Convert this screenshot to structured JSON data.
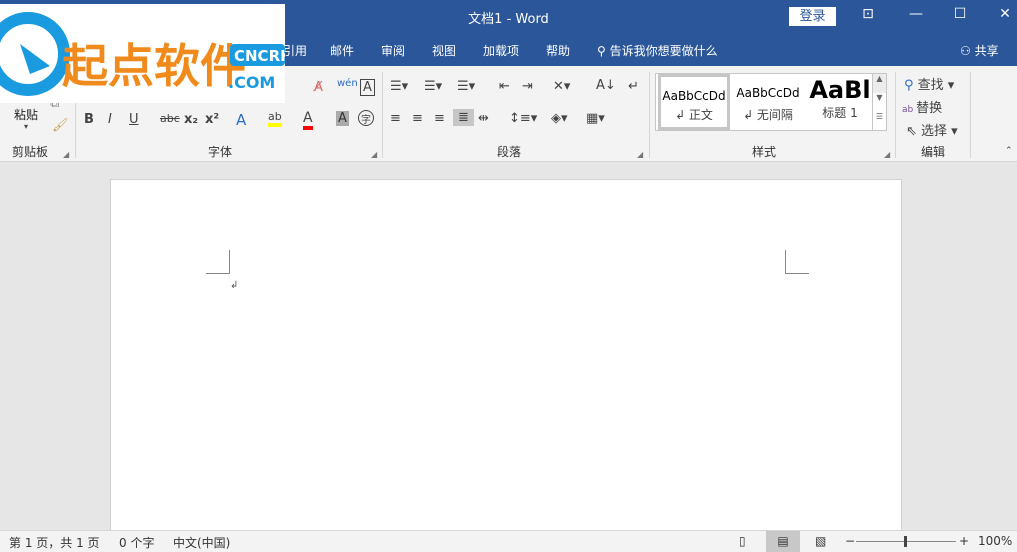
{
  "title": "文档1  -  Word",
  "login": "登录",
  "tabs": [
    "引用",
    "邮件",
    "审阅",
    "视图",
    "加载项",
    "帮助"
  ],
  "tell_me": "告诉我你想要做什么",
  "share": "共享",
  "groups": {
    "clipboard": "剪贴板",
    "font": "字体",
    "paragraph": "段落",
    "styles": "样式",
    "editing": "编辑"
  },
  "paste": "粘贴",
  "font_buttons": {
    "bold": "B",
    "italic": "I",
    "underline": "U",
    "strike": "abc",
    "sub": "x₂",
    "sup": "x²",
    "phonetic": "wén",
    "enclosed": "字"
  },
  "styles": [
    {
      "sample": "AaBbCcDd",
      "name": "↲ 正文"
    },
    {
      "sample": "AaBbCcDd",
      "name": "↲ 无间隔"
    },
    {
      "sample": "AaBl",
      "name": "标题 1"
    }
  ],
  "editing": {
    "find": "查找",
    "replace": "替换",
    "select": "选择"
  },
  "status": {
    "page": "第 1 页，共 1 页",
    "words": "0 个字",
    "lang": "中文(中国)",
    "zoom": "100%"
  },
  "logo": {
    "cn": "起点软件",
    "en1": "CNCRK",
    ".com": ".COM"
  },
  "colors": {
    "brand": "#2b579a",
    "highlight": "#ffff00",
    "font_color": "#ff0000",
    "logo_orange": "#f08a1c",
    "logo_blue": "#1a9be0"
  }
}
